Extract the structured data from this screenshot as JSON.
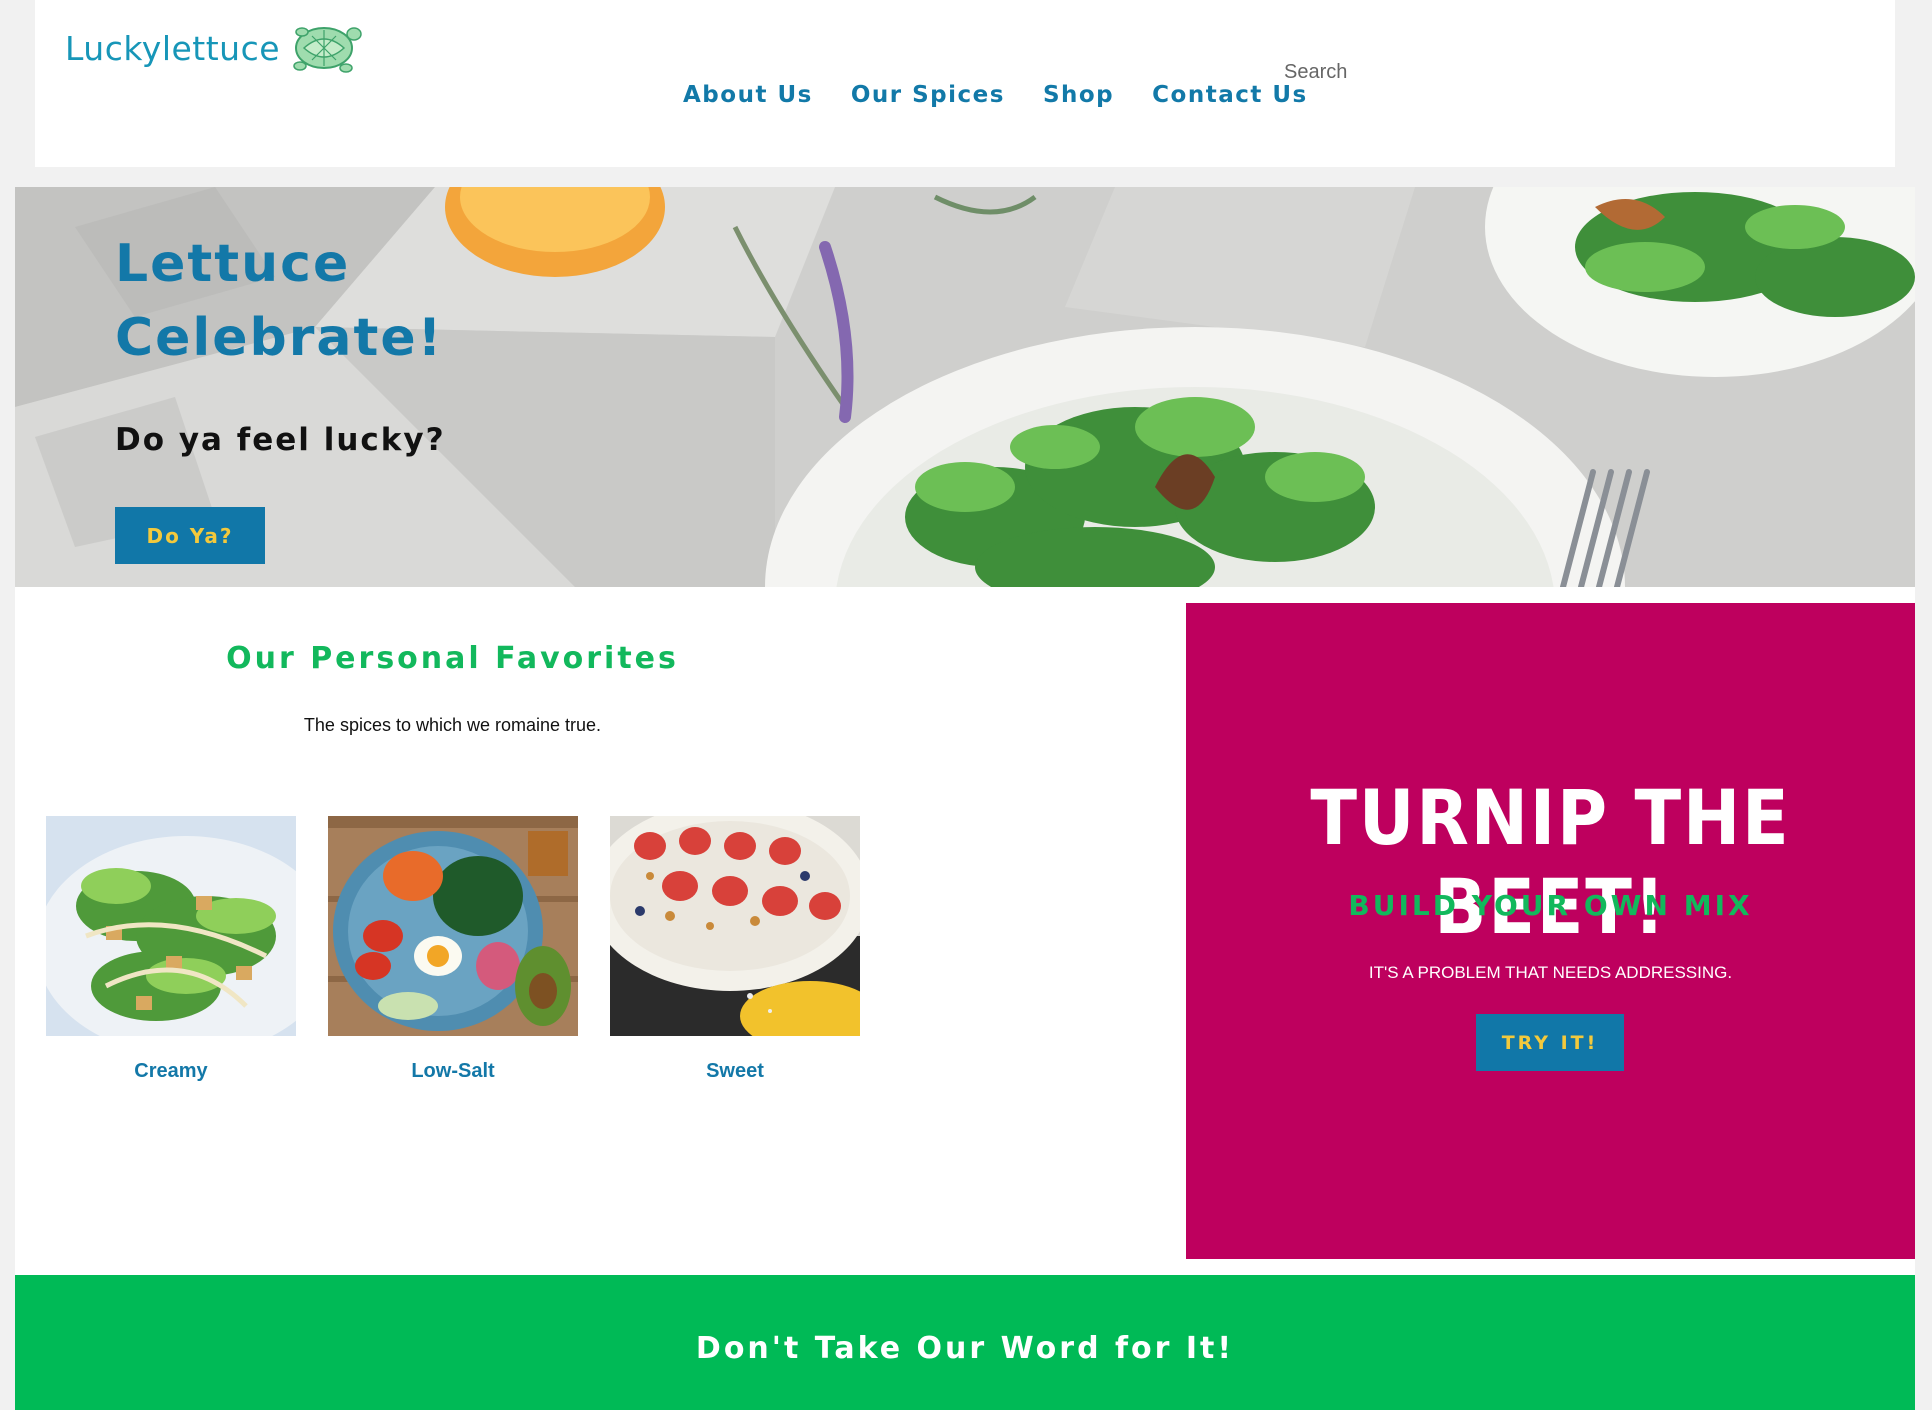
{
  "brand": {
    "name": "Luckylettuce",
    "logo_icon": "lettuce-turtle-icon",
    "color": "#1796b8"
  },
  "nav": {
    "items": [
      {
        "label": "About Us"
      },
      {
        "label": "Our Spices"
      },
      {
        "label": "Shop"
      },
      {
        "label": "Contact Us"
      }
    ]
  },
  "search": {
    "placeholder": "Search",
    "value": ""
  },
  "hero": {
    "title": "Lettuce Celebrate!",
    "subtitle": "Do ya feel lucky?",
    "button_label": "Do Ya?"
  },
  "favorites": {
    "title": "Our Personal Favorites",
    "subtitle": "The spices to which we romaine true.",
    "items": [
      {
        "caption": "Creamy",
        "image": "caesar-salad-photo"
      },
      {
        "caption": "Low-Salt",
        "image": "egg-avocado-bowl-photo"
      },
      {
        "caption": "Sweet",
        "image": "strawberry-plate-photo"
      }
    ]
  },
  "promo": {
    "title": "TURNIP THE BEET!",
    "subtitle": "BUILD YOUR OWN MIX",
    "text": "IT'S A PROBLEM THAT NEEDS ADDRESSING.",
    "button_label": "TRY IT!",
    "background": "#be005e"
  },
  "testimonials": {
    "title": "Don't Take Our Word for It!",
    "background": "#00ba56"
  },
  "colors": {
    "accent_blue": "#1177a8",
    "button_text": "#f3c93c",
    "green": "#12b85c"
  }
}
